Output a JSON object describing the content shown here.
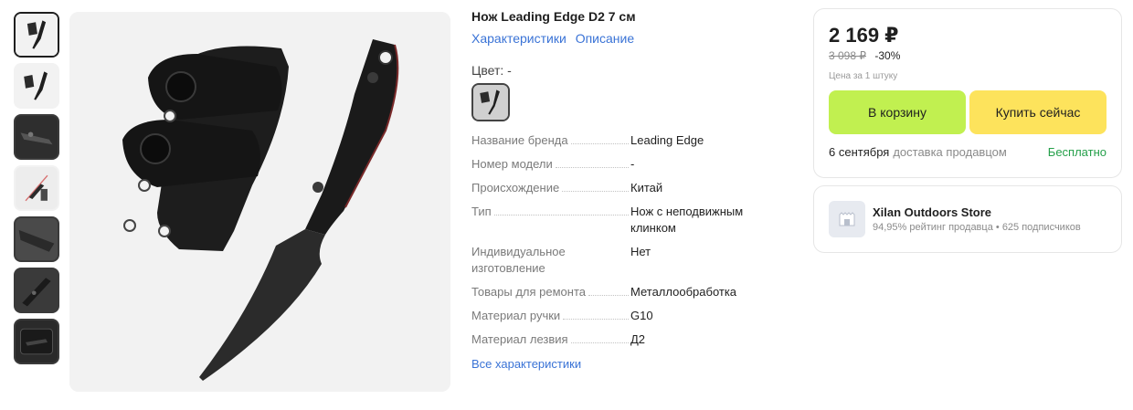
{
  "product": {
    "title": "Нож Leading Edge D2 7 см",
    "links": [
      "Характеристики",
      "Описание"
    ],
    "color_label": "Цвет: -",
    "specs": [
      {
        "name": "Название бренда",
        "value": "Leading Edge"
      },
      {
        "name": "Номер модели",
        "value": "-"
      },
      {
        "name": "Происхождение",
        "value": "Китай"
      },
      {
        "name": "Тип",
        "value": "Нож с неподвижным клинком"
      },
      {
        "name": "Индивидуальное изготовление",
        "value": "Нет"
      },
      {
        "name": "Товары для ремонта",
        "value": "Металлообработка"
      },
      {
        "name": "Материал ручки",
        "value": "G10"
      },
      {
        "name": "Материал лезвия",
        "value": "Д2"
      }
    ],
    "all_specs_label": "Все характеристики"
  },
  "thumbnails": [
    {
      "icon": "knife-with-sheath-thumb"
    },
    {
      "icon": "knife-thumb"
    },
    {
      "icon": "knife-closeup-thumb"
    },
    {
      "icon": "knife-size-thumb"
    },
    {
      "icon": "blade-closeup-thumb"
    },
    {
      "icon": "handle-closeup-thumb"
    },
    {
      "icon": "knife-box-thumb"
    }
  ],
  "buy": {
    "price": "2 169 ₽",
    "old_price": "3 098 ₽",
    "discount": "-30%",
    "per_unit": "Цена за 1 штуку",
    "cart_label": "В корзину",
    "buy_now_label": "Купить сейчас",
    "delivery_date": "6 сентября",
    "delivery_by": "доставка продавцом",
    "delivery_cost": "Бесплатно"
  },
  "store": {
    "name": "Xilan Outdoors Store",
    "rating": "94,95% рейтинг продавца",
    "subscribers": "625 подписчиков"
  },
  "colors": {
    "link": "#3a73d6",
    "cart_button": "#c1f050",
    "buy_button": "#fde35c",
    "free_delivery": "#25a04a"
  }
}
